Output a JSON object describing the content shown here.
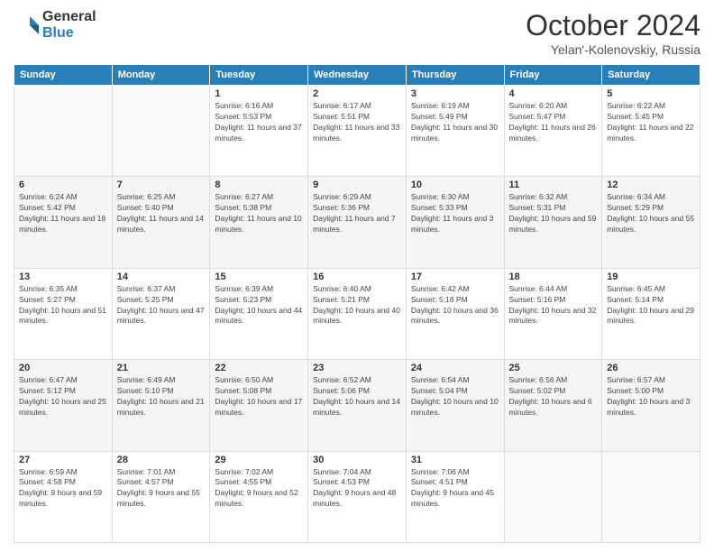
{
  "header": {
    "logo_general": "General",
    "logo_blue": "Blue",
    "month_title": "October 2024",
    "location": "Yelan'-Kolenovskiy, Russia"
  },
  "weekdays": [
    "Sunday",
    "Monday",
    "Tuesday",
    "Wednesday",
    "Thursday",
    "Friday",
    "Saturday"
  ],
  "weeks": [
    [
      {
        "day": "",
        "info": ""
      },
      {
        "day": "",
        "info": ""
      },
      {
        "day": "1",
        "info": "Sunrise: 6:16 AM\nSunset: 5:53 PM\nDaylight: 11 hours and 37 minutes."
      },
      {
        "day": "2",
        "info": "Sunrise: 6:17 AM\nSunset: 5:51 PM\nDaylight: 11 hours and 33 minutes."
      },
      {
        "day": "3",
        "info": "Sunrise: 6:19 AM\nSunset: 5:49 PM\nDaylight: 11 hours and 30 minutes."
      },
      {
        "day": "4",
        "info": "Sunrise: 6:20 AM\nSunset: 5:47 PM\nDaylight: 11 hours and 26 minutes."
      },
      {
        "day": "5",
        "info": "Sunrise: 6:22 AM\nSunset: 5:45 PM\nDaylight: 11 hours and 22 minutes."
      }
    ],
    [
      {
        "day": "6",
        "info": "Sunrise: 6:24 AM\nSunset: 5:42 PM\nDaylight: 11 hours and 18 minutes."
      },
      {
        "day": "7",
        "info": "Sunrise: 6:25 AM\nSunset: 5:40 PM\nDaylight: 11 hours and 14 minutes."
      },
      {
        "day": "8",
        "info": "Sunrise: 6:27 AM\nSunset: 5:38 PM\nDaylight: 11 hours and 10 minutes."
      },
      {
        "day": "9",
        "info": "Sunrise: 6:29 AM\nSunset: 5:36 PM\nDaylight: 11 hours and 7 minutes."
      },
      {
        "day": "10",
        "info": "Sunrise: 6:30 AM\nSunset: 5:33 PM\nDaylight: 11 hours and 3 minutes."
      },
      {
        "day": "11",
        "info": "Sunrise: 6:32 AM\nSunset: 5:31 PM\nDaylight: 10 hours and 59 minutes."
      },
      {
        "day": "12",
        "info": "Sunrise: 6:34 AM\nSunset: 5:29 PM\nDaylight: 10 hours and 55 minutes."
      }
    ],
    [
      {
        "day": "13",
        "info": "Sunrise: 6:35 AM\nSunset: 5:27 PM\nDaylight: 10 hours and 51 minutes."
      },
      {
        "day": "14",
        "info": "Sunrise: 6:37 AM\nSunset: 5:25 PM\nDaylight: 10 hours and 47 minutes."
      },
      {
        "day": "15",
        "info": "Sunrise: 6:39 AM\nSunset: 5:23 PM\nDaylight: 10 hours and 44 minutes."
      },
      {
        "day": "16",
        "info": "Sunrise: 6:40 AM\nSunset: 5:21 PM\nDaylight: 10 hours and 40 minutes."
      },
      {
        "day": "17",
        "info": "Sunrise: 6:42 AM\nSunset: 5:18 PM\nDaylight: 10 hours and 36 minutes."
      },
      {
        "day": "18",
        "info": "Sunrise: 6:44 AM\nSunset: 5:16 PM\nDaylight: 10 hours and 32 minutes."
      },
      {
        "day": "19",
        "info": "Sunrise: 6:45 AM\nSunset: 5:14 PM\nDaylight: 10 hours and 29 minutes."
      }
    ],
    [
      {
        "day": "20",
        "info": "Sunrise: 6:47 AM\nSunset: 5:12 PM\nDaylight: 10 hours and 25 minutes."
      },
      {
        "day": "21",
        "info": "Sunrise: 6:49 AM\nSunset: 5:10 PM\nDaylight: 10 hours and 21 minutes."
      },
      {
        "day": "22",
        "info": "Sunrise: 6:50 AM\nSunset: 5:08 PM\nDaylight: 10 hours and 17 minutes."
      },
      {
        "day": "23",
        "info": "Sunrise: 6:52 AM\nSunset: 5:06 PM\nDaylight: 10 hours and 14 minutes."
      },
      {
        "day": "24",
        "info": "Sunrise: 6:54 AM\nSunset: 5:04 PM\nDaylight: 10 hours and 10 minutes."
      },
      {
        "day": "25",
        "info": "Sunrise: 6:56 AM\nSunset: 5:02 PM\nDaylight: 10 hours and 6 minutes."
      },
      {
        "day": "26",
        "info": "Sunrise: 6:57 AM\nSunset: 5:00 PM\nDaylight: 10 hours and 3 minutes."
      }
    ],
    [
      {
        "day": "27",
        "info": "Sunrise: 6:59 AM\nSunset: 4:58 PM\nDaylight: 9 hours and 59 minutes."
      },
      {
        "day": "28",
        "info": "Sunrise: 7:01 AM\nSunset: 4:57 PM\nDaylight: 9 hours and 55 minutes."
      },
      {
        "day": "29",
        "info": "Sunrise: 7:02 AM\nSunset: 4:55 PM\nDaylight: 9 hours and 52 minutes."
      },
      {
        "day": "30",
        "info": "Sunrise: 7:04 AM\nSunset: 4:53 PM\nDaylight: 9 hours and 48 minutes."
      },
      {
        "day": "31",
        "info": "Sunrise: 7:06 AM\nSunset: 4:51 PM\nDaylight: 9 hours and 45 minutes."
      },
      {
        "day": "",
        "info": ""
      },
      {
        "day": "",
        "info": ""
      }
    ]
  ]
}
